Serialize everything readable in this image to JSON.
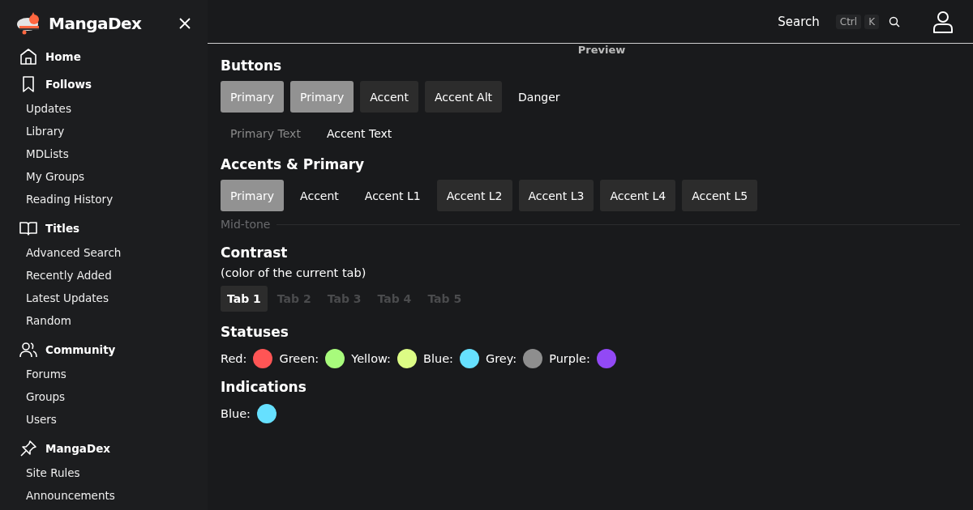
{
  "sidebar": {
    "brand": "MangaDex",
    "sections": [
      {
        "kind": "home",
        "title": "Home"
      },
      {
        "kind": "bookmark",
        "title": "Follows",
        "items": [
          "Updates",
          "Library",
          "MDLists",
          "My Groups",
          "Reading History"
        ]
      },
      {
        "kind": "book",
        "title": "Titles",
        "items": [
          "Advanced Search",
          "Recently Added",
          "Latest Updates",
          "Random"
        ]
      },
      {
        "kind": "people",
        "title": "Community",
        "items": [
          "Forums",
          "Groups",
          "Users"
        ]
      },
      {
        "kind": "pin",
        "title": "MangaDex",
        "items": [
          "Site Rules",
          "Announcements"
        ]
      }
    ]
  },
  "header": {
    "search": {
      "placeholder": "Search"
    },
    "shortcut": [
      "Ctrl",
      "K"
    ]
  },
  "preview_label": "Preview",
  "buttons": {
    "title": "Buttons",
    "rows": [
      [
        {
          "label": "Primary",
          "kind": "primary"
        },
        {
          "label": "Primary",
          "kind": "primary"
        },
        {
          "label": "Accent",
          "kind": "accent"
        },
        {
          "label": "Accent Alt",
          "kind": "accent"
        },
        {
          "label": "Danger",
          "kind": "plain"
        }
      ],
      [
        {
          "label": "Primary Text",
          "kind": "muted"
        },
        {
          "label": "Accent Text",
          "kind": "plain"
        }
      ]
    ]
  },
  "accents": {
    "title": "Accents & Primary",
    "buttons": [
      {
        "label": "Primary",
        "kind": "primary"
      },
      {
        "label": "Accent",
        "kind": "plain"
      },
      {
        "label": "Accent L1",
        "kind": "plain"
      },
      {
        "label": "Accent L2",
        "kind": "accent"
      },
      {
        "label": "Accent L3",
        "kind": "accent"
      },
      {
        "label": "Accent L4",
        "kind": "accent"
      },
      {
        "label": "Accent L5",
        "kind": "accent"
      }
    ]
  },
  "mid_tone": "Mid-tone",
  "contrast": {
    "title": "Contrast",
    "note": "(color of the current tab)",
    "tabs": [
      {
        "label": "Tab 1",
        "selected": true
      },
      {
        "label": "Tab 2",
        "selected": false
      },
      {
        "label": "Tab 3",
        "selected": false
      },
      {
        "label": "Tab 4",
        "selected": false
      },
      {
        "label": "Tab 5",
        "selected": false
      }
    ]
  },
  "statuses": {
    "title": "Statuses",
    "items": [
      {
        "label": "Red:",
        "color": "#ff5555"
      },
      {
        "label": "Green:",
        "color": "#a8fb7c"
      },
      {
        "label": "Yellow:",
        "color": "#dcfc85"
      },
      {
        "label": "Blue:",
        "color": "#66e0ff"
      },
      {
        "label": "Grey:",
        "color": "#8e8e8e"
      },
      {
        "label": "Purple:",
        "color": "#9249f5"
      }
    ]
  },
  "indications": {
    "title": "Indications",
    "items": [
      {
        "label": "Blue:",
        "color": "#66e0ff"
      }
    ]
  }
}
